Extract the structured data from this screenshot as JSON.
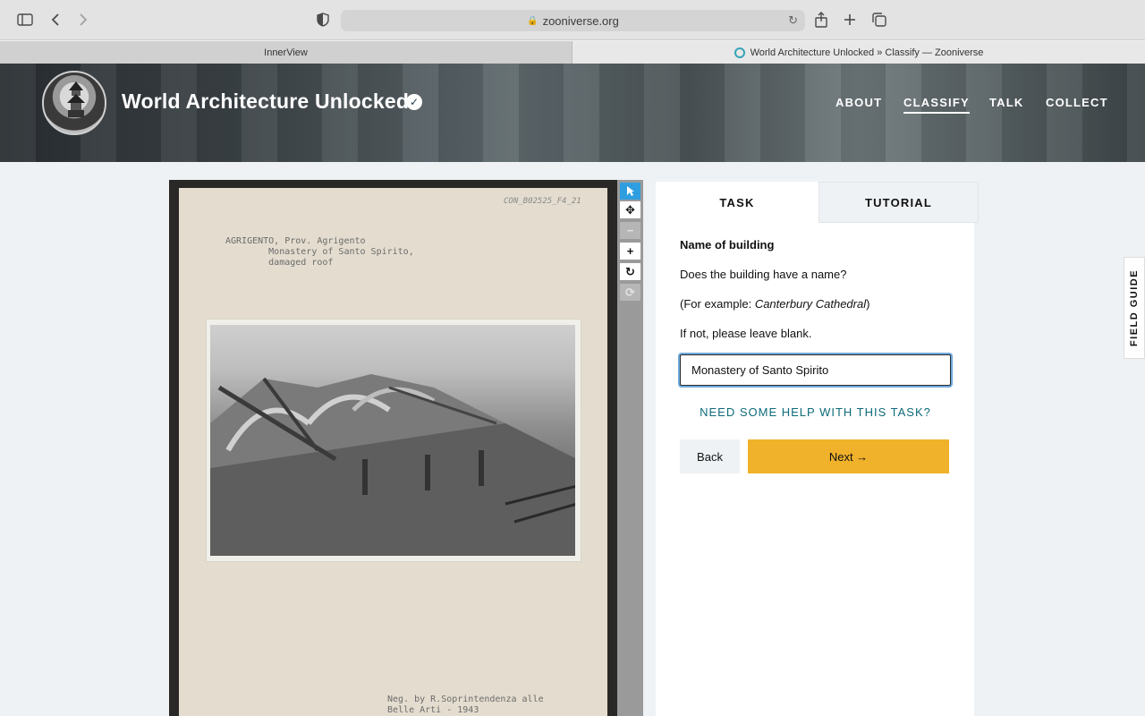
{
  "browser": {
    "url": "zooniverse.org",
    "tabs": [
      {
        "label": "InnerView"
      },
      {
        "label": "World Architecture Unlocked » Classify — Zooniverse"
      }
    ]
  },
  "header": {
    "title": "World Architecture Unlocked",
    "nav": [
      {
        "label": "ABOUT"
      },
      {
        "label": "CLASSIFY",
        "active": true
      },
      {
        "label": "TALK"
      },
      {
        "label": "COLLECT"
      }
    ]
  },
  "subject": {
    "typed_caption": "AGRIGENTO, Prov. Agrigento\n        Monastery of Santo Spirito,\n        damaged roof",
    "handwritten_id": "CON_B02525_F4_21",
    "footer_caption": "Neg. by R.Soprintendenza alle\nBelle Arti - 1943"
  },
  "task_panel": {
    "tabs": [
      {
        "label": "TASK",
        "active": true
      },
      {
        "label": "TUTORIAL"
      }
    ],
    "question_title": "Name of building",
    "question": "Does the building have a name?",
    "example_prefix": "(For example: ",
    "example_name": "Canterbury Cathedral",
    "example_suffix": ")",
    "instruction": "If not, please leave blank.",
    "answer_value": "Monastery of Santo Spirito",
    "help_link": "NEED SOME HELP WITH THIS TASK?",
    "back_label": "Back",
    "next_label": "Next →"
  },
  "field_guide": {
    "label": "FIELD GUIDE"
  },
  "colors": {
    "accent": "#f0b12b",
    "link": "#0e6b7a",
    "tool_active": "#2f9ee0"
  }
}
